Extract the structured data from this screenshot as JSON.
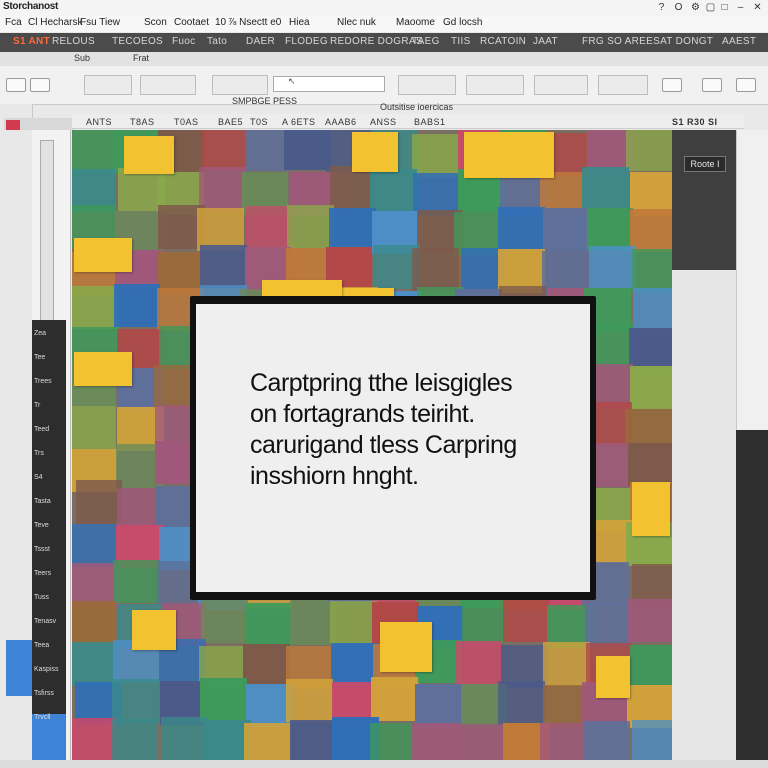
{
  "window": {
    "title": "Storchanost",
    "controls": [
      "?",
      "O",
      "⚙",
      "▢",
      "□",
      "–",
      "✕"
    ]
  },
  "menu": {
    "items": [
      "Fca",
      "Cl Hecharsk",
      "Fsu Tiew",
      "Scon",
      "Cootaet",
      "10",
      "⅞ Nsectt e0",
      "Hiea",
      "Nlec nuk",
      "Maoome",
      "Gd locsh"
    ]
  },
  "ribbon": {
    "tabs": [
      "S1 ANT",
      "RELOUS",
      "TECOEOS",
      "Fuoc",
      "Tato",
      "DAER",
      "FLODEG",
      "REDORE DOGRAS",
      "TAEG",
      "TIIS",
      "RCATOIN",
      "JAAT",
      "FRG SO AREESAT DONGT",
      "AAEST"
    ],
    "active_tab": "S1 ANT"
  },
  "subribbon": {
    "items": [
      "Sub",
      "Frat"
    ]
  },
  "toolbar": {
    "search_value": "",
    "group_label": "SMPBGE PESS",
    "caption": "Outsitise ioercicas"
  },
  "ruler": {
    "labels": [
      "ANTS",
      "T8AS",
      "T0AS",
      "BAE5",
      "T0S",
      "A 6ETS",
      "AAAB6",
      "ANSS",
      "BABS1"
    ],
    "zoom": "S1 R30 SI"
  },
  "layers": {
    "items": [
      "Zea",
      "Tee",
      "Trees",
      "Tr",
      "Teed",
      "Trs",
      "S4",
      "Tasta",
      "Teve",
      "Tssst",
      "Teers",
      "Tuss",
      "Tenasv",
      "Teea",
      "Kaspiss",
      "Tsfirss",
      "Trvcll"
    ]
  },
  "right_panel": {
    "tag": "Roote I"
  },
  "dialog": {
    "lines": [
      "Carptpring tthe leisgigles",
      "on fortagrands teiriht.",
      "carurigand tless Carpring",
      "insshiorn hnght."
    ]
  },
  "colors": {
    "ribbon_bg": "#4b4b4b",
    "ribbon_active": "#ff6a3d",
    "canvas_bg": "#7a6e62",
    "dialog_border": "#111111",
    "dialog_bg": "#efefef"
  }
}
